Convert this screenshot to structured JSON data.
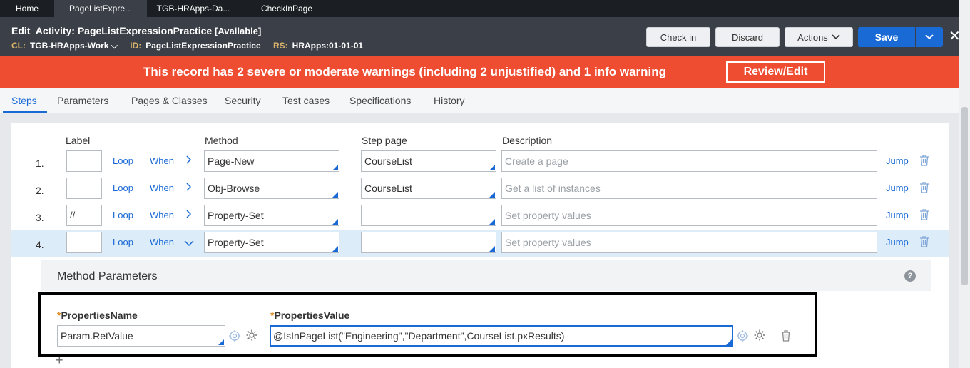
{
  "tabs": [
    {
      "label": "Home"
    },
    {
      "label": "PageListExpre..."
    },
    {
      "label": "TGB-HRApps-Da..."
    },
    {
      "label": "CheckInPage"
    }
  ],
  "header": {
    "title_prefix": "Edit",
    "title": "Activity: PageListExpressionPractice",
    "status": "[Available]",
    "cl_key": "CL:",
    "cl_value": "TGB-HRApps-Work",
    "id_key": "ID:",
    "id_value": "PageListExpressionPractice",
    "rs_key": "RS:",
    "rs_value": "HRApps:01-01-01",
    "check_in": "Check in",
    "discard": "Discard",
    "actions": "Actions",
    "save": "Save"
  },
  "banner": {
    "text": "This record has 2 severe or moderate warnings (including 2 unjustified) and 1 info warning",
    "button": "Review/Edit"
  },
  "rule_tabs": [
    "Steps",
    "Parameters",
    "Pages & Classes",
    "Security",
    "Test cases",
    "Specifications",
    "History"
  ],
  "columns": {
    "label": "Label",
    "method": "Method",
    "step_page": "Step page",
    "description": "Description"
  },
  "steps": [
    {
      "num": "1.",
      "label": "",
      "loop": "Loop",
      "when": "When",
      "method": "Page-New",
      "step_page": "CourseList",
      "description": "Create a page",
      "jump": "Jump"
    },
    {
      "num": "2.",
      "label": "",
      "loop": "Loop",
      "when": "When",
      "method": "Obj-Browse",
      "step_page": "CourseList",
      "description": "Get a list of instances",
      "jump": "Jump"
    },
    {
      "num": "3.",
      "label": "//",
      "loop": "Loop",
      "when": "When",
      "method": "Property-Set",
      "step_page": "",
      "description": "Set property values",
      "jump": "Jump"
    },
    {
      "num": "4.",
      "label": "",
      "loop": "Loop",
      "when": "When",
      "method": "Property-Set",
      "step_page": "",
      "description": "Set property values",
      "jump": "Jump"
    }
  ],
  "method_params": {
    "title": "Method Parameters",
    "help": "?",
    "name_label": "PropertiesName",
    "value_label": "PropertiesValue",
    "name_value": "Param.RetValue",
    "value_value": "@IsInPageList(\"Engineering\",\"Department\",CourseList.pxResults)",
    "add": "+"
  },
  "colors": {
    "accent": "#1a6ad6",
    "banner": "#ef4d32",
    "header": "#3b4048",
    "tabbar": "#1b1e22"
  }
}
